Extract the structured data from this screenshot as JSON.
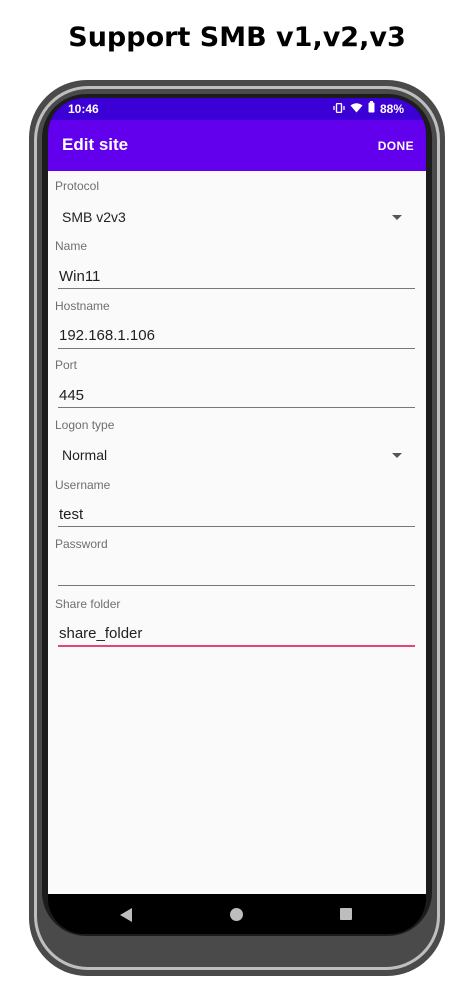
{
  "headline": "Support SMB v1,v2,v3",
  "status_bar": {
    "time": "10:46",
    "battery": "88%",
    "icons": [
      "vibrate-icon",
      "wifi-icon",
      "battery-icon"
    ]
  },
  "app_bar": {
    "title": "Edit site",
    "done_label": "DONE"
  },
  "form": {
    "protocol": {
      "label": "Protocol",
      "value": "SMB v2v3"
    },
    "name": {
      "label": "Name",
      "value": "Win11"
    },
    "hostname": {
      "label": "Hostname",
      "value": "192.168.1.106"
    },
    "port": {
      "label": "Port",
      "value": "445"
    },
    "logon_type": {
      "label": "Logon type",
      "value": "Normal"
    },
    "username": {
      "label": "Username",
      "value": "test"
    },
    "password": {
      "label": "Password",
      "value": ""
    },
    "share_folder": {
      "label": "Share folder",
      "value": "share_folder"
    }
  },
  "colors": {
    "status_bar": "#3a00d6",
    "app_bar": "#6200ee",
    "focus_accent": "#e0457b"
  }
}
